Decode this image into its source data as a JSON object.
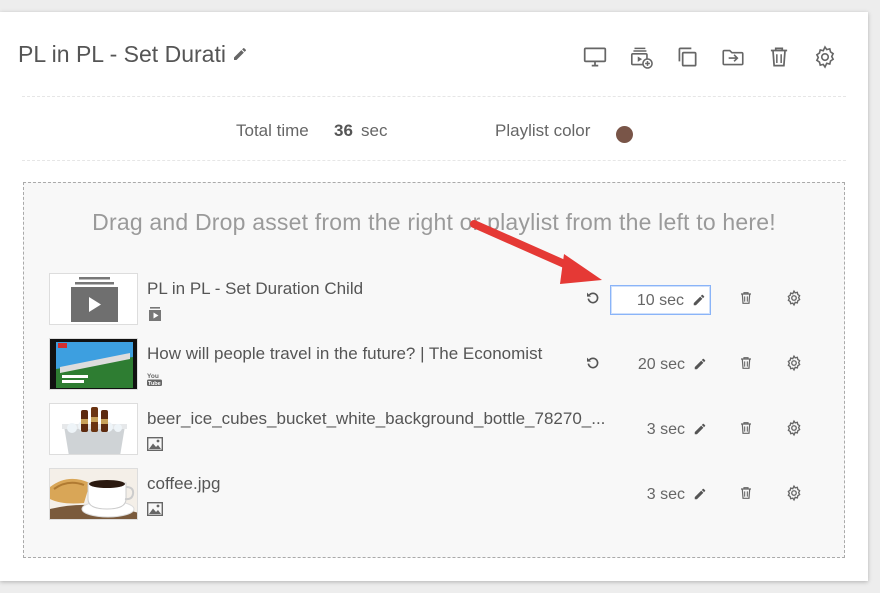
{
  "playlist": {
    "title": "PL in PL - Set Durati",
    "toolbar": [
      "monitor-icon",
      "add-media-icon",
      "duplicate-icon",
      "export-icon",
      "trash-icon",
      "gear-icon"
    ]
  },
  "info": {
    "total_label": "Total time",
    "total_value": "36",
    "total_unit": "sec",
    "color_label": "Playlist color",
    "color_value": "#795548"
  },
  "dropzone": {
    "hint": "Drag and Drop asset from the right or playlist from the left to here!"
  },
  "items": [
    {
      "name": "PL in PL - Set Duration Child",
      "duration": "10 sec",
      "type_icon": "playlist-icon",
      "revert": true
    },
    {
      "name": "How will people travel in the future? | The Economist",
      "duration": "20 sec",
      "type_icon": "youtube-icon",
      "revert": true
    },
    {
      "name": "beer_ice_cubes_bucket_white_background_bottle_78270_...",
      "duration": "3 sec",
      "type_icon": "image-icon",
      "revert": false
    },
    {
      "name": "coffee.jpg",
      "duration": "3 sec",
      "type_icon": "image-icon",
      "revert": false
    }
  ],
  "colors": {
    "annotation_arrow": "#e53935",
    "focus_border": "#8ab4f8"
  }
}
